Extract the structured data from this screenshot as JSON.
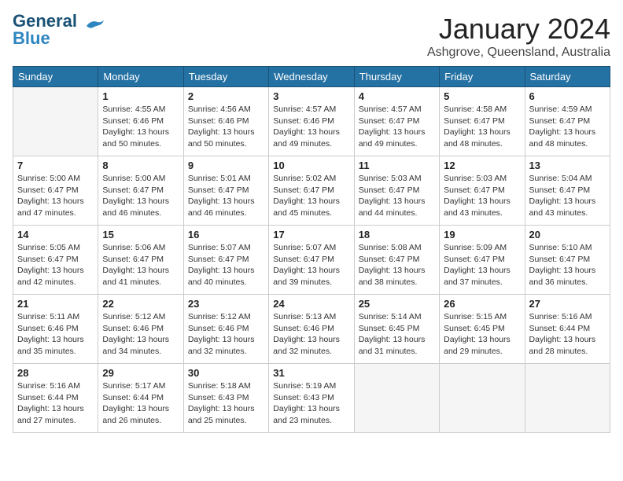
{
  "header": {
    "logo_line1": "General",
    "logo_line2": "Blue",
    "month_title": "January 2024",
    "location": "Ashgrove, Queensland, Australia"
  },
  "columns": [
    "Sunday",
    "Monday",
    "Tuesday",
    "Wednesday",
    "Thursday",
    "Friday",
    "Saturday"
  ],
  "weeks": [
    [
      {
        "day": "",
        "info": ""
      },
      {
        "day": "1",
        "info": "Sunrise: 4:55 AM\nSunset: 6:46 PM\nDaylight: 13 hours\nand 50 minutes."
      },
      {
        "day": "2",
        "info": "Sunrise: 4:56 AM\nSunset: 6:46 PM\nDaylight: 13 hours\nand 50 minutes."
      },
      {
        "day": "3",
        "info": "Sunrise: 4:57 AM\nSunset: 6:46 PM\nDaylight: 13 hours\nand 49 minutes."
      },
      {
        "day": "4",
        "info": "Sunrise: 4:57 AM\nSunset: 6:47 PM\nDaylight: 13 hours\nand 49 minutes."
      },
      {
        "day": "5",
        "info": "Sunrise: 4:58 AM\nSunset: 6:47 PM\nDaylight: 13 hours\nand 48 minutes."
      },
      {
        "day": "6",
        "info": "Sunrise: 4:59 AM\nSunset: 6:47 PM\nDaylight: 13 hours\nand 48 minutes."
      }
    ],
    [
      {
        "day": "7",
        "info": "Sunrise: 5:00 AM\nSunset: 6:47 PM\nDaylight: 13 hours\nand 47 minutes."
      },
      {
        "day": "8",
        "info": "Sunrise: 5:00 AM\nSunset: 6:47 PM\nDaylight: 13 hours\nand 46 minutes."
      },
      {
        "day": "9",
        "info": "Sunrise: 5:01 AM\nSunset: 6:47 PM\nDaylight: 13 hours\nand 46 minutes."
      },
      {
        "day": "10",
        "info": "Sunrise: 5:02 AM\nSunset: 6:47 PM\nDaylight: 13 hours\nand 45 minutes."
      },
      {
        "day": "11",
        "info": "Sunrise: 5:03 AM\nSunset: 6:47 PM\nDaylight: 13 hours\nand 44 minutes."
      },
      {
        "day": "12",
        "info": "Sunrise: 5:03 AM\nSunset: 6:47 PM\nDaylight: 13 hours\nand 43 minutes."
      },
      {
        "day": "13",
        "info": "Sunrise: 5:04 AM\nSunset: 6:47 PM\nDaylight: 13 hours\nand 43 minutes."
      }
    ],
    [
      {
        "day": "14",
        "info": "Sunrise: 5:05 AM\nSunset: 6:47 PM\nDaylight: 13 hours\nand 42 minutes."
      },
      {
        "day": "15",
        "info": "Sunrise: 5:06 AM\nSunset: 6:47 PM\nDaylight: 13 hours\nand 41 minutes."
      },
      {
        "day": "16",
        "info": "Sunrise: 5:07 AM\nSunset: 6:47 PM\nDaylight: 13 hours\nand 40 minutes."
      },
      {
        "day": "17",
        "info": "Sunrise: 5:07 AM\nSunset: 6:47 PM\nDaylight: 13 hours\nand 39 minutes."
      },
      {
        "day": "18",
        "info": "Sunrise: 5:08 AM\nSunset: 6:47 PM\nDaylight: 13 hours\nand 38 minutes."
      },
      {
        "day": "19",
        "info": "Sunrise: 5:09 AM\nSunset: 6:47 PM\nDaylight: 13 hours\nand 37 minutes."
      },
      {
        "day": "20",
        "info": "Sunrise: 5:10 AM\nSunset: 6:47 PM\nDaylight: 13 hours\nand 36 minutes."
      }
    ],
    [
      {
        "day": "21",
        "info": "Sunrise: 5:11 AM\nSunset: 6:46 PM\nDaylight: 13 hours\nand 35 minutes."
      },
      {
        "day": "22",
        "info": "Sunrise: 5:12 AM\nSunset: 6:46 PM\nDaylight: 13 hours\nand 34 minutes."
      },
      {
        "day": "23",
        "info": "Sunrise: 5:12 AM\nSunset: 6:46 PM\nDaylight: 13 hours\nand 32 minutes."
      },
      {
        "day": "24",
        "info": "Sunrise: 5:13 AM\nSunset: 6:46 PM\nDaylight: 13 hours\nand 32 minutes."
      },
      {
        "day": "25",
        "info": "Sunrise: 5:14 AM\nSunset: 6:45 PM\nDaylight: 13 hours\nand 31 minutes."
      },
      {
        "day": "26",
        "info": "Sunrise: 5:15 AM\nSunset: 6:45 PM\nDaylight: 13 hours\nand 29 minutes."
      },
      {
        "day": "27",
        "info": "Sunrise: 5:16 AM\nSunset: 6:44 PM\nDaylight: 13 hours\nand 28 minutes."
      }
    ],
    [
      {
        "day": "28",
        "info": "Sunrise: 5:16 AM\nSunset: 6:44 PM\nDaylight: 13 hours\nand 27 minutes."
      },
      {
        "day": "29",
        "info": "Sunrise: 5:17 AM\nSunset: 6:44 PM\nDaylight: 13 hours\nand 26 minutes."
      },
      {
        "day": "30",
        "info": "Sunrise: 5:18 AM\nSunset: 6:43 PM\nDaylight: 13 hours\nand 25 minutes."
      },
      {
        "day": "31",
        "info": "Sunrise: 5:19 AM\nSunset: 6:43 PM\nDaylight: 13 hours\nand 23 minutes."
      },
      {
        "day": "",
        "info": ""
      },
      {
        "day": "",
        "info": ""
      },
      {
        "day": "",
        "info": ""
      }
    ]
  ]
}
